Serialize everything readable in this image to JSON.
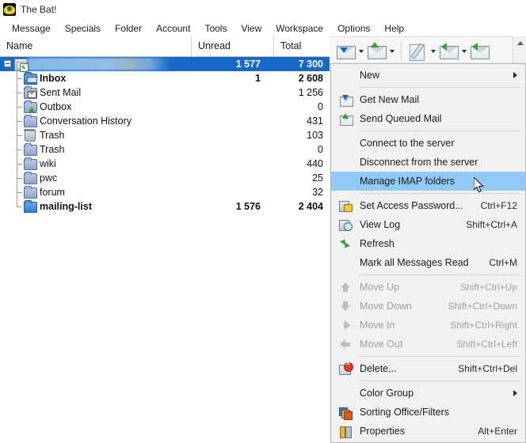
{
  "window": {
    "title": "The Bat!",
    "app_icon": "bat-logo-icon"
  },
  "menubar": {
    "items": [
      {
        "label": "Message"
      },
      {
        "label": "Specials"
      },
      {
        "label": "Folder"
      },
      {
        "label": "Account"
      },
      {
        "label": "Tools"
      },
      {
        "label": "View"
      },
      {
        "label": "Workspace"
      },
      {
        "label": "Options"
      },
      {
        "label": "Help"
      }
    ]
  },
  "toolbar": {
    "buttons": [
      {
        "name": "get-new-mail-button",
        "icon": "envelope-download-icon",
        "has_dropdown": true
      },
      {
        "name": "send-queued-mail-button",
        "icon": "envelope-up-arrow-icon",
        "has_dropdown": true
      },
      {
        "name": "new-message-button",
        "icon": "paper-pen-icon",
        "has_dropdown": true
      },
      {
        "name": "reply-button",
        "icon": "envelope-reply-icon",
        "has_dropdown": true
      },
      {
        "name": "reply-all-button",
        "icon": "envelope-reply-all-icon",
        "has_dropdown": true
      }
    ]
  },
  "folder_list": {
    "columns": [
      {
        "label": "Name"
      },
      {
        "label": "Unread"
      },
      {
        "label": "Total"
      }
    ],
    "rows": [
      {
        "name": "",
        "redacted": true,
        "icon": "account-checked-icon",
        "unread": "1 577",
        "total": "7 300",
        "selected": true,
        "bold": true,
        "level": 0
      },
      {
        "name": "Inbox",
        "icon": "inbox-folder-icon",
        "unread": "1",
        "total": "2 608",
        "bold": true,
        "level": 1
      },
      {
        "name": "Sent Mail",
        "icon": "sent-folder-icon",
        "unread": "",
        "total": "1 256",
        "bold": false,
        "level": 1
      },
      {
        "name": "Outbox",
        "icon": "outbox-folder-icon",
        "unread": "",
        "total": "0",
        "bold": false,
        "level": 1
      },
      {
        "name": "Conversation History",
        "icon": "folder-icon",
        "unread": "",
        "total": "431",
        "bold": false,
        "level": 1
      },
      {
        "name": "Trash",
        "icon": "trash-icon",
        "unread": "",
        "total": "103",
        "bold": false,
        "level": 1
      },
      {
        "name": "Trash",
        "icon": "folder-icon",
        "unread": "",
        "total": "0",
        "bold": false,
        "level": 1
      },
      {
        "name": "wiki",
        "icon": "folder-icon",
        "unread": "",
        "total": "440",
        "bold": false,
        "level": 1
      },
      {
        "name": "pwc",
        "icon": "folder-icon",
        "unread": "",
        "total": "25",
        "bold": false,
        "level": 1
      },
      {
        "name": "forum",
        "icon": "folder-icon",
        "unread": "",
        "total": "32",
        "bold": false,
        "level": 1
      },
      {
        "name": "mailing-list",
        "icon": "folder-blue-icon",
        "unread": "1 576",
        "total": "2 404",
        "bold": true,
        "level": 1
      }
    ]
  },
  "context_menu": {
    "items": [
      {
        "type": "item",
        "label": "New",
        "shortcut": "",
        "icon": "",
        "submenu": true,
        "disabled": false,
        "highlighted": false
      },
      {
        "type": "separator"
      },
      {
        "type": "item",
        "label": "Get New Mail",
        "shortcut": "",
        "icon": "envelope-download-icon",
        "submenu": false,
        "disabled": false,
        "highlighted": false
      },
      {
        "type": "item",
        "label": "Send Queued Mail",
        "shortcut": "",
        "icon": "envelope-up-arrow-icon",
        "submenu": false,
        "disabled": false,
        "highlighted": false
      },
      {
        "type": "separator"
      },
      {
        "type": "item",
        "label": "Connect to the server",
        "shortcut": "",
        "icon": "",
        "submenu": false,
        "disabled": false,
        "highlighted": false
      },
      {
        "type": "item",
        "label": "Disconnect from the server",
        "shortcut": "",
        "icon": "",
        "submenu": false,
        "disabled": false,
        "highlighted": false
      },
      {
        "type": "item",
        "label": "Manage IMAP folders",
        "shortcut": "",
        "icon": "",
        "submenu": false,
        "disabled": false,
        "highlighted": true
      },
      {
        "type": "separator"
      },
      {
        "type": "item",
        "label": "Set Access Password...",
        "shortcut": "Ctrl+F12",
        "icon": "padlock-icon",
        "submenu": false,
        "disabled": false,
        "highlighted": false
      },
      {
        "type": "item",
        "label": "View Log",
        "shortcut": "Shift+Ctrl+A",
        "icon": "log-clock-icon",
        "submenu": false,
        "disabled": false,
        "highlighted": false
      },
      {
        "type": "item",
        "label": "Refresh",
        "shortcut": "",
        "icon": "refresh-icon",
        "submenu": false,
        "disabled": false,
        "highlighted": false
      },
      {
        "type": "item",
        "label": "Mark all Messages Read",
        "shortcut": "Ctrl+M",
        "icon": "",
        "submenu": false,
        "disabled": false,
        "highlighted": false
      },
      {
        "type": "separator"
      },
      {
        "type": "item",
        "label": "Move Up",
        "shortcut": "Shift+Ctrl+Up",
        "icon": "arrow-up-icon",
        "submenu": false,
        "disabled": true,
        "highlighted": false
      },
      {
        "type": "item",
        "label": "Move Down",
        "shortcut": "Shift+Ctrl+Down",
        "icon": "arrow-down-icon",
        "submenu": false,
        "disabled": true,
        "highlighted": false
      },
      {
        "type": "item",
        "label": "Move In",
        "shortcut": "Shift+Ctrl+Right",
        "icon": "arrow-right-icon",
        "submenu": false,
        "disabled": true,
        "highlighted": false
      },
      {
        "type": "item",
        "label": "Move Out",
        "shortcut": "Shift+Ctrl+Left",
        "icon": "arrow-left-icon",
        "submenu": false,
        "disabled": true,
        "highlighted": false
      },
      {
        "type": "separator"
      },
      {
        "type": "item",
        "label": "Delete...",
        "shortcut": "Shift+Ctrl+Del",
        "icon": "delete-folder-icon",
        "submenu": false,
        "disabled": false,
        "highlighted": false
      },
      {
        "type": "separator"
      },
      {
        "type": "item",
        "label": "Color Group",
        "shortcut": "",
        "icon": "",
        "submenu": true,
        "disabled": false,
        "highlighted": false
      },
      {
        "type": "item",
        "label": "Sorting Office/Filters",
        "shortcut": "",
        "icon": "sorting-office-icon",
        "submenu": false,
        "disabled": false,
        "highlighted": false
      },
      {
        "type": "item",
        "label": "Properties",
        "shortcut": "Alt+Enter",
        "icon": "properties-tools-icon",
        "submenu": false,
        "disabled": false,
        "highlighted": false
      }
    ]
  },
  "colors": {
    "selection_blue": "#1669c6",
    "menu_highlight": "#91c9f7",
    "menu_background": "#f1f1f1",
    "window_background": "#ffffff"
  }
}
